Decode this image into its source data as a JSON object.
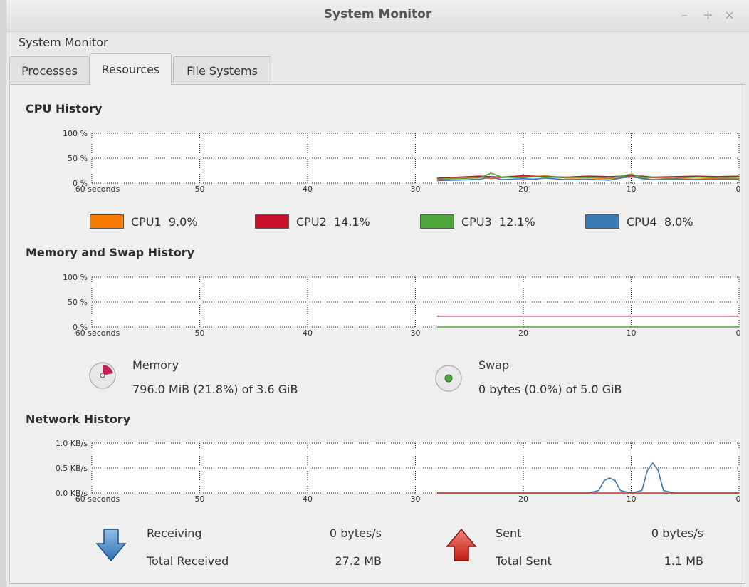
{
  "window": {
    "title": "System Monitor",
    "controls": [
      "–",
      "+",
      "×"
    ]
  },
  "menubar": {
    "title": "System Monitor"
  },
  "tabs": [
    {
      "label": "Processes",
      "active": false
    },
    {
      "label": "Resources",
      "active": true
    },
    {
      "label": "File Systems",
      "active": false
    }
  ],
  "cpu": {
    "title": "CPU History",
    "legend": [
      {
        "label": "CPU1",
        "value": "9.0%",
        "color": "#f57900"
      },
      {
        "label": "CPU2",
        "value": "14.1%",
        "color": "#c9102a"
      },
      {
        "label": "CPU3",
        "value": "12.1%",
        "color": "#4ea63a"
      },
      {
        "label": "CPU4",
        "value": "8.0%",
        "color": "#3a7bb6"
      }
    ]
  },
  "memory": {
    "title": "Memory and Swap History",
    "memory_label": "Memory",
    "memory_value": "796.0 MiB (21.8%) of 3.6 GiB",
    "memory_color": "#c0245a",
    "swap_label": "Swap",
    "swap_value": "0 bytes (0.0%) of 5.0 GiB",
    "swap_color": "#4ea63a"
  },
  "network": {
    "title": "Network History",
    "receiving_label": "Receiving",
    "receiving_value": "0 bytes/s",
    "total_received_label": "Total Received",
    "total_received_value": "27.2 MB",
    "sent_label": "Sent",
    "sent_value": "0 bytes/s",
    "total_sent_label": "Total Sent",
    "total_sent_value": "1.1 MB",
    "receiving_color": "#3a7bb6",
    "sent_color": "#e0281b"
  },
  "chart_data": [
    {
      "type": "line",
      "name": "cpu-history",
      "xlabel": "",
      "ylabel": "",
      "x_ticks": [
        "60 seconds",
        "50",
        "40",
        "30",
        "20",
        "10",
        "0"
      ],
      "y_ticks": [
        "100 %",
        "50 %",
        "0 %"
      ],
      "xlim": [
        60,
        0
      ],
      "ylim": [
        0,
        100
      ],
      "x": [
        28,
        26,
        24,
        23,
        22,
        20,
        19,
        18,
        16,
        14,
        12,
        10,
        9,
        8,
        6,
        4,
        2,
        0
      ],
      "series": [
        {
          "name": "CPU1",
          "color": "#f57900",
          "values": [
            7,
            10,
            12,
            9,
            11,
            14,
            12,
            15,
            10,
            11,
            9,
            12,
            10,
            11,
            9,
            8,
            10,
            9
          ]
        },
        {
          "name": "CPU2",
          "color": "#c9102a",
          "values": [
            10,
            12,
            14,
            13,
            12,
            15,
            14,
            13,
            12,
            14,
            13,
            15,
            14,
            12,
            13,
            14,
            13,
            14
          ]
        },
        {
          "name": "CPU3",
          "color": "#4ea63a",
          "values": [
            8,
            9,
            11,
            20,
            12,
            11,
            13,
            12,
            11,
            12,
            10,
            18,
            12,
            11,
            10,
            12,
            11,
            12
          ]
        },
        {
          "name": "CPU4",
          "color": "#3a7bb6",
          "values": [
            5,
            6,
            8,
            12,
            7,
            9,
            8,
            10,
            7,
            8,
            6,
            14,
            9,
            7,
            8,
            7,
            8,
            8
          ]
        }
      ]
    },
    {
      "type": "line",
      "name": "memory-swap-history",
      "xlabel": "",
      "ylabel": "",
      "x_ticks": [
        "60 seconds",
        "50",
        "40",
        "30",
        "20",
        "10",
        "0"
      ],
      "y_ticks": [
        "100 %",
        "50 %",
        "0 %"
      ],
      "xlim": [
        60,
        0
      ],
      "ylim": [
        0,
        100
      ],
      "x": [
        28,
        0
      ],
      "series": [
        {
          "name": "Memory",
          "color": "#c0245a",
          "values": [
            21.8,
            21.8
          ]
        },
        {
          "name": "Swap",
          "color": "#4ea63a",
          "values": [
            0,
            0
          ]
        }
      ]
    },
    {
      "type": "line",
      "name": "network-history",
      "xlabel": "",
      "ylabel": "",
      "x_ticks": [
        "60 seconds",
        "50",
        "40",
        "30",
        "20",
        "10",
        "0"
      ],
      "y_ticks": [
        "1.0 KB/s",
        "0.5 KB/s",
        "0.0 KB/s"
      ],
      "xlim": [
        60,
        0
      ],
      "ylim": [
        0,
        1.0
      ],
      "series": [
        {
          "name": "Receiving",
          "color": "#3a7bb6",
          "x": [
            28,
            14,
            13,
            12.5,
            12,
            11.5,
            11,
            10,
            9,
            8.5,
            8,
            7.5,
            7,
            6,
            0
          ],
          "values": [
            0,
            0,
            0.05,
            0.25,
            0.3,
            0.25,
            0.05,
            0,
            0.05,
            0.45,
            0.6,
            0.45,
            0.05,
            0,
            0
          ]
        },
        {
          "name": "Sent",
          "color": "#e0281b",
          "x": [
            28,
            0
          ],
          "values": [
            0,
            0
          ]
        }
      ]
    }
  ]
}
